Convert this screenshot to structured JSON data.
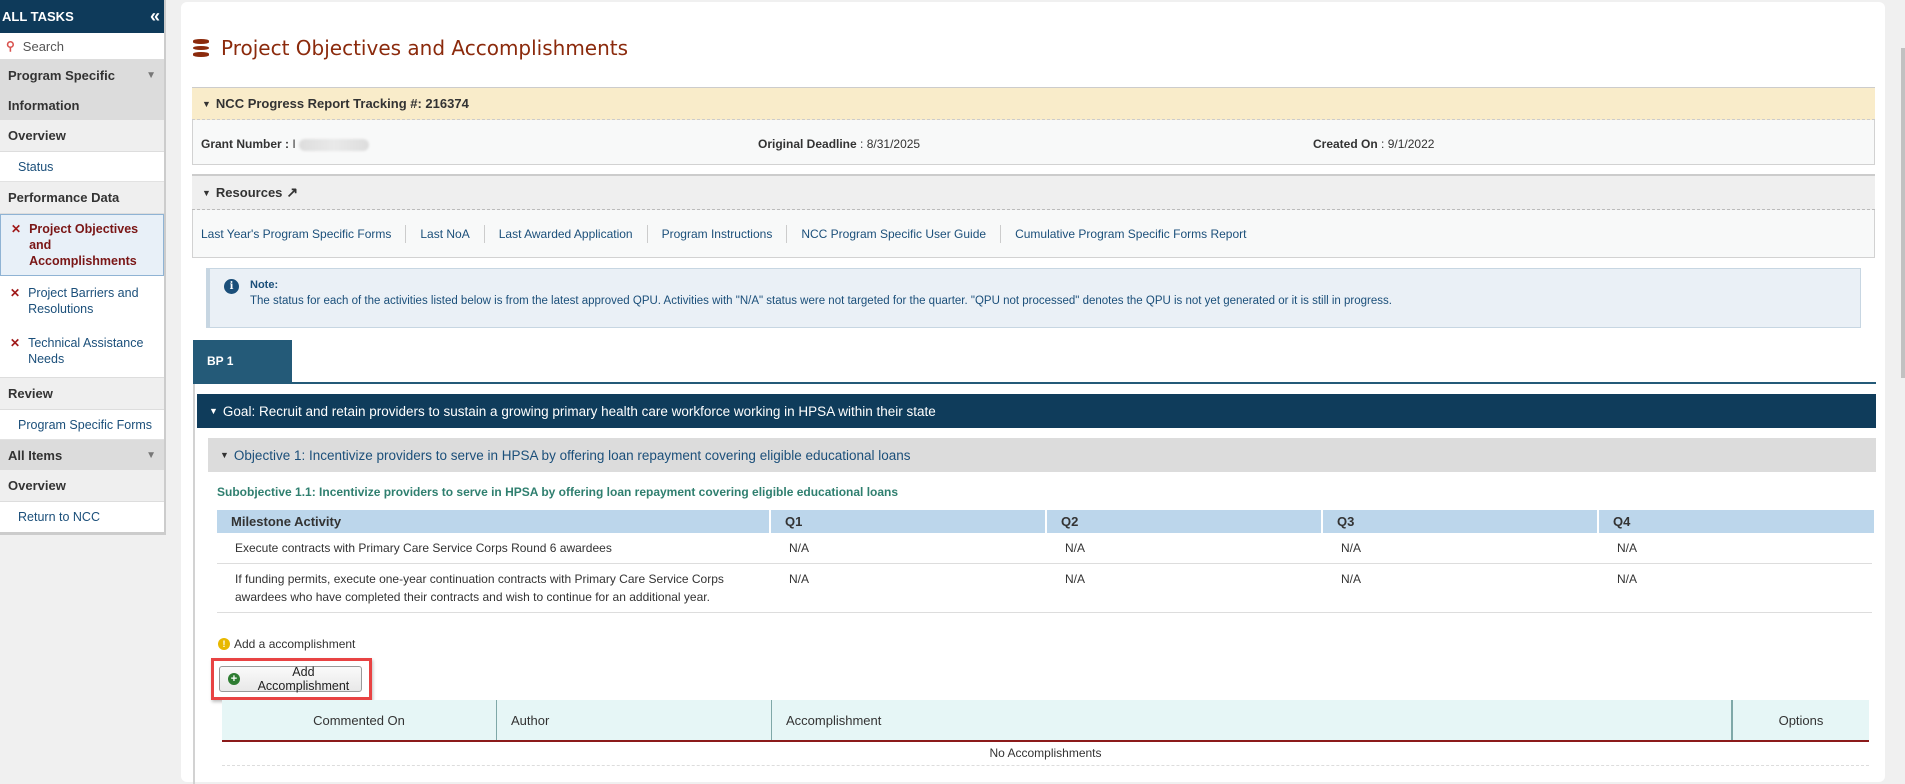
{
  "sidebar": {
    "header": "ALL TASKS",
    "collapse_icon": "double-chevron-left",
    "search_placeholder": "Search",
    "groups": [
      {
        "label_line1": "Program Specific",
        "label_line2": "Information"
      },
      {
        "label": "All Items"
      }
    ],
    "overview_1": "Overview",
    "status_link": "Status",
    "performance_data": "Performance Data",
    "tasks": [
      {
        "label": "Project Objectives and Accomplishments",
        "active": true
      },
      {
        "label": "Project Barriers and Resolutions",
        "active": false
      },
      {
        "label": "Technical Assistance Needs",
        "active": false
      }
    ],
    "review": "Review",
    "program_specific_forms": "Program Specific Forms",
    "overview_2": "Overview",
    "return_link": "Return to NCC"
  },
  "page": {
    "title": "Project Objectives and Accomplishments",
    "title_icon": "database-icon"
  },
  "ncc": {
    "header": "NCC Progress Report Tracking #: 216374",
    "grant_label": "Grant Number :",
    "grant_value": "I",
    "deadline_label": "Original Deadline",
    "deadline_value": ": 8/31/2025",
    "created_label": "Created On",
    "created_value": ": 9/1/2022"
  },
  "resources": {
    "header": "Resources",
    "links": [
      "Last Year's Program Specific Forms",
      "Last NoA",
      "Last Awarded Application",
      "Program Instructions",
      "NCC Program Specific User Guide",
      "Cumulative Program Specific Forms Report"
    ]
  },
  "note": {
    "label": "Note:",
    "text": "The status for each of the activities listed below is from the latest approved QPU. Activities with \"N/A\" status were not targeted for the quarter. \"QPU not processed\" denotes the QPU is not yet generated or it is still in progress."
  },
  "tabs": [
    {
      "label": "BP 1",
      "active": true
    }
  ],
  "goal": "Goal: Recruit and retain providers to sustain a growing primary health care workforce working in HPSA within their state",
  "objective": "Objective 1: Incentivize providers to serve in HPSA by offering loan repayment covering eligible educational loans",
  "subobjective": "Subobjective 1.1: Incentivize providers to serve in HPSA by offering loan repayment covering eligible educational loans",
  "milestones": {
    "headers": [
      "Milestone Activity",
      "Q1",
      "Q2",
      "Q3",
      "Q4"
    ],
    "rows": [
      {
        "activity": "Execute contracts with Primary Care Service Corps Round 6 awardees",
        "q": [
          "N/A",
          "N/A",
          "N/A",
          "N/A"
        ]
      },
      {
        "activity": "If funding permits, execute one-year continuation contracts with Primary Care Service Corps awardees who have completed their contracts and wish to continue for an additional year.",
        "q": [
          "N/A",
          "N/A",
          "N/A",
          "N/A"
        ]
      }
    ]
  },
  "accomplishments": {
    "hint": "Add a accomplishment",
    "add_button": "Add Accomplishment",
    "headers": [
      "Commented On",
      "Author",
      "Accomplishment",
      "Options"
    ],
    "empty": "No Accomplishments"
  },
  "colors": {
    "nav_dark": "#0e3a5a",
    "title": "#8b2a0c",
    "tab": "#245a78",
    "highlight": "#e84343",
    "ncc_header_bg": "#f9ecca"
  }
}
